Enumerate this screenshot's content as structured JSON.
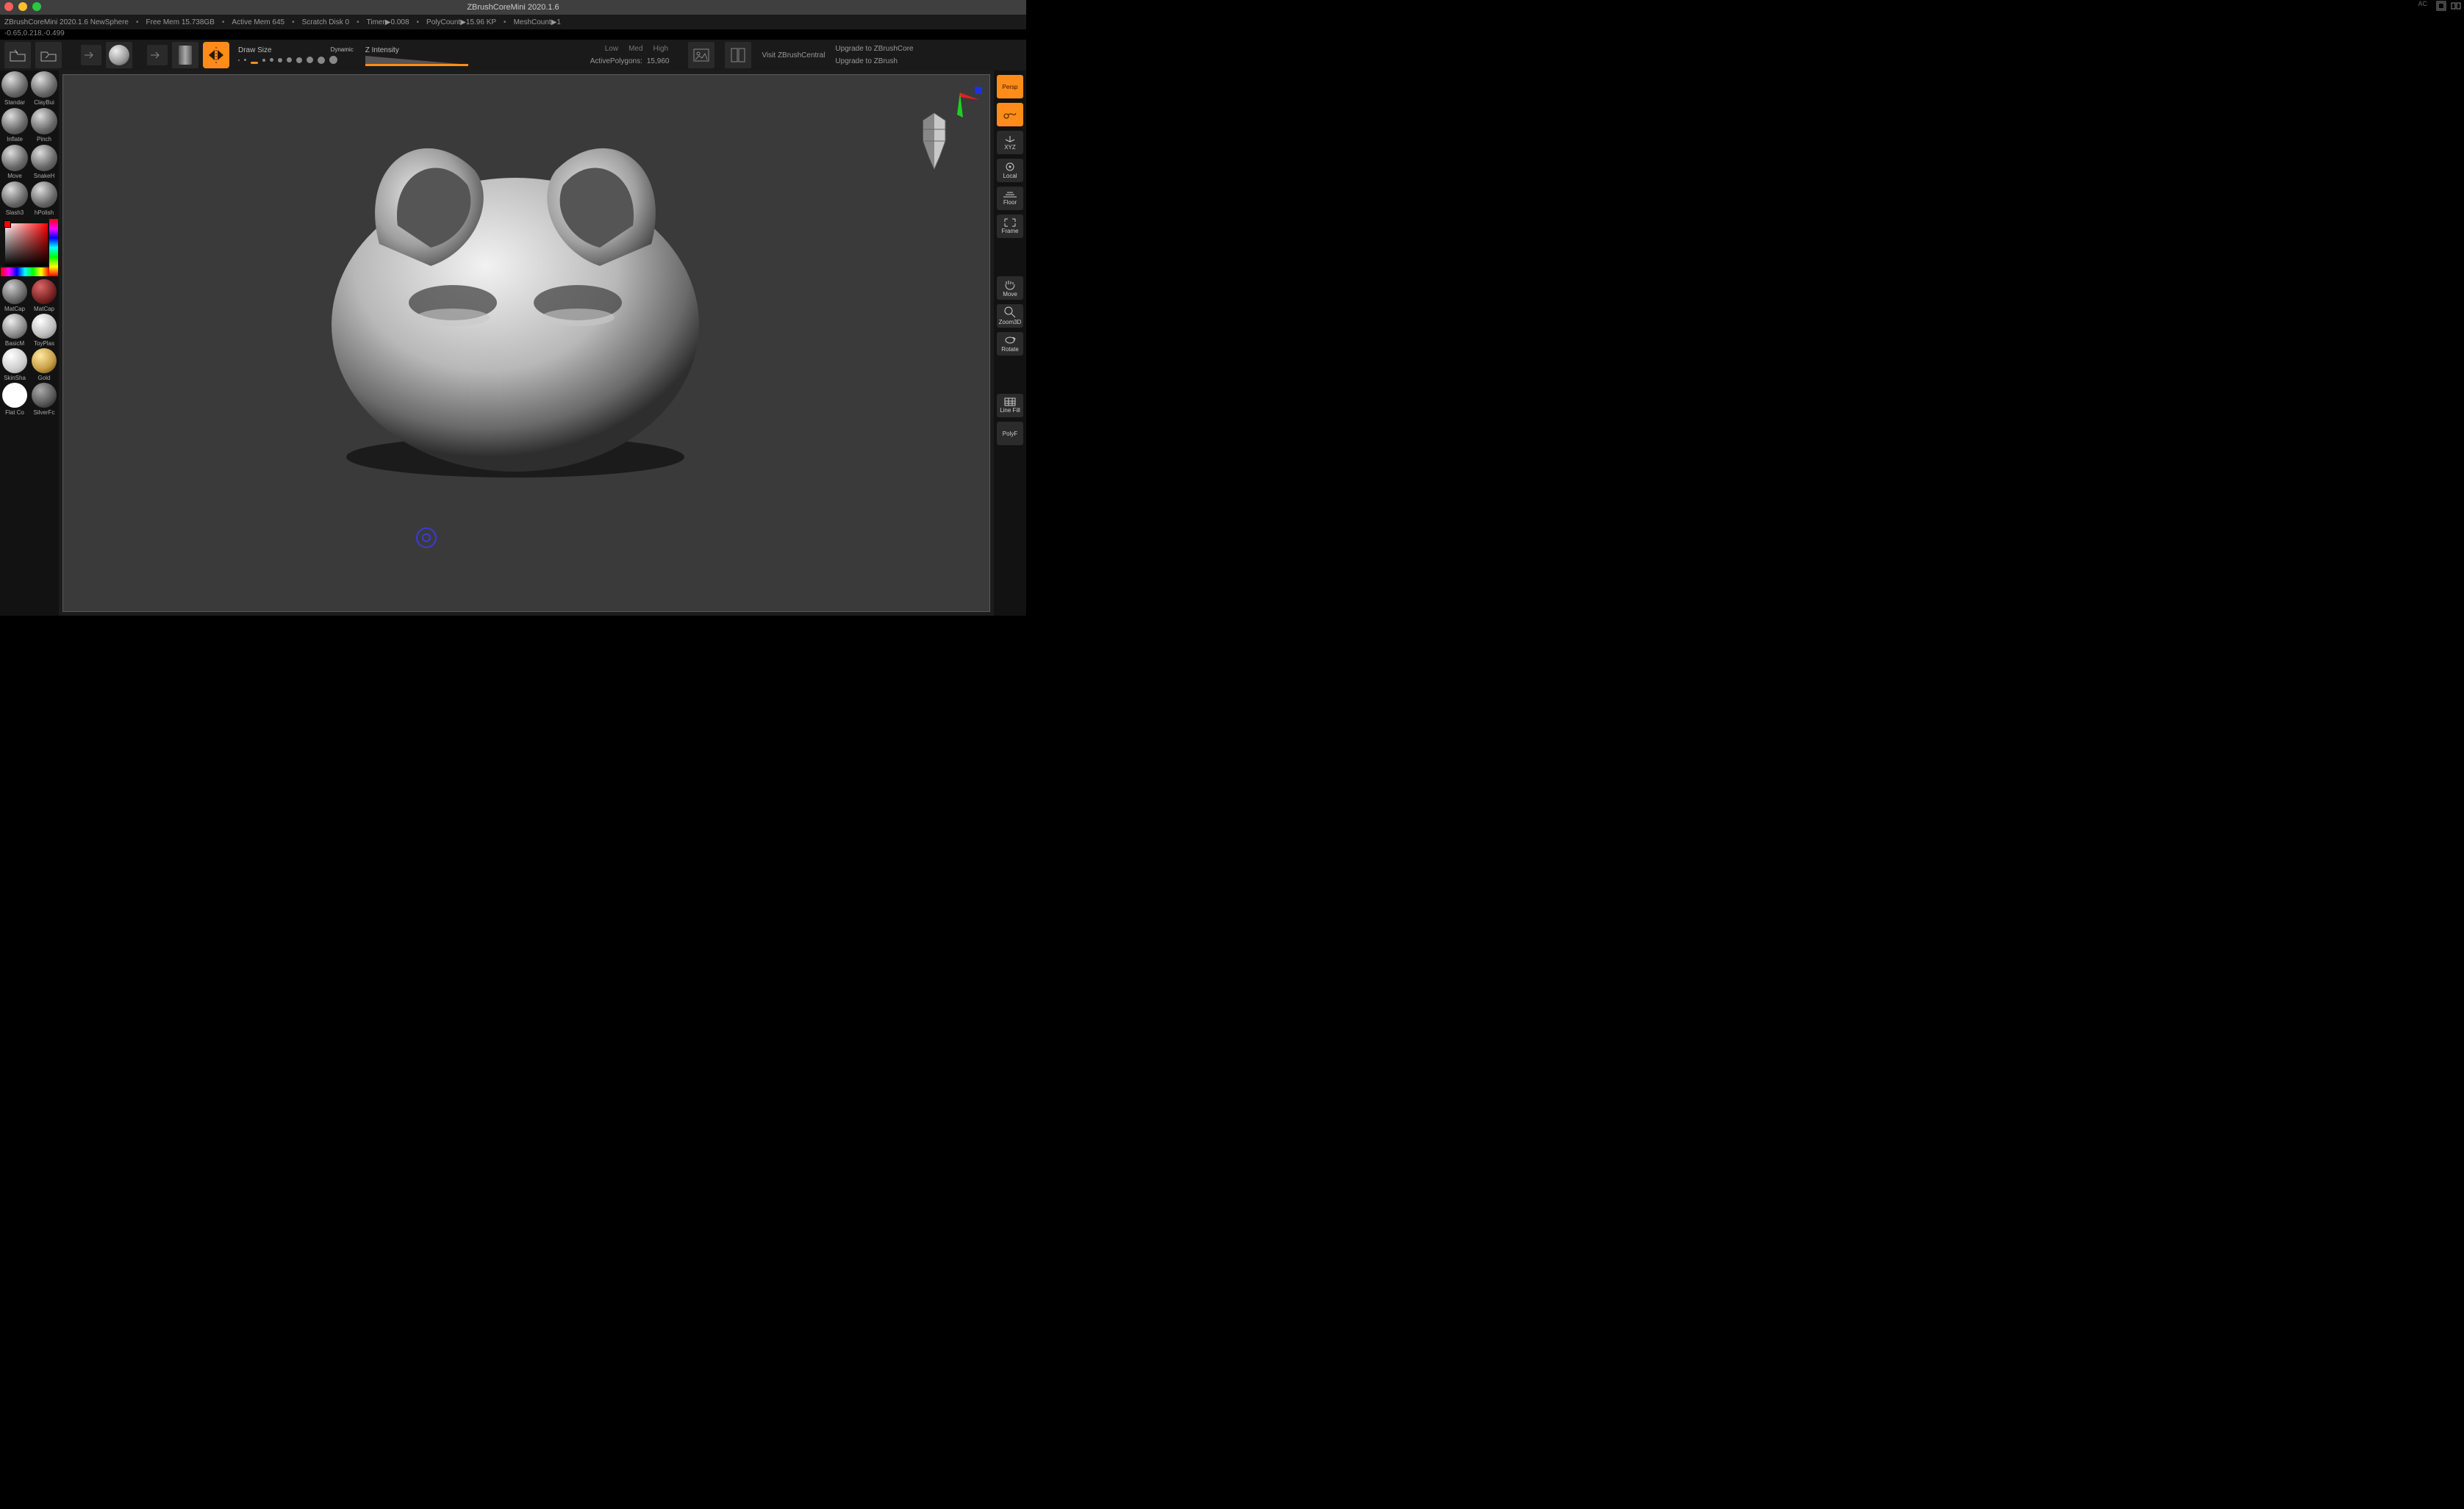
{
  "title": "ZBrushCoreMini 2020.1.6",
  "info": {
    "app": "ZBrushCoreMini 2020.1.6 NewSphere",
    "freemem_label": "Free Mem",
    "freemem": "15.738GB",
    "activemem_label": "Active Mem",
    "activemem": "645",
    "scratch_label": "Scratch Disk",
    "scratch": "0",
    "timer_label": "Timer",
    "timer": "0.008",
    "polycount_label": "PolyCount",
    "polycount": "15.96 KP",
    "meshcount_label": "MeshCount",
    "meshcount": "1",
    "ac": "AC"
  },
  "coords": "-0.65,0.218,-0.499",
  "toolbar": {
    "drawsize_label": "Draw Size",
    "dynamic_label": "Dynamic",
    "zintensity_label": "Z Intensity",
    "quality": [
      "Low",
      "Med",
      "High"
    ],
    "activepoly_label": "ActivePolygons:",
    "activepoly": "15,960",
    "visit": "Visit ZBrushCentral",
    "upgrade1": "Upgrade to ZBrushCore",
    "upgrade2": "Upgrade to ZBrush"
  },
  "brushes": [
    {
      "label": "Standar"
    },
    {
      "label": "ClayBui"
    },
    {
      "label": "Inflate"
    },
    {
      "label": "Pinch"
    },
    {
      "label": "Move"
    },
    {
      "label": "SnakeH"
    },
    {
      "label": "Slash3"
    },
    {
      "label": "hPolish"
    }
  ],
  "materials": [
    {
      "label": "MatCap",
      "bg": "radial-gradient(circle at 35% 30%,#ccc,#666 60%,#222)"
    },
    {
      "label": "MatCap",
      "bg": "radial-gradient(circle at 35% 30%,#d66,#722 60%,#200)"
    },
    {
      "label": "BasicM",
      "bg": "radial-gradient(circle at 35% 30%,#eee,#888 60%,#333)"
    },
    {
      "label": "ToyPlas",
      "bg": "radial-gradient(circle at 35% 30%,#fff,#bbb 60%,#666)"
    },
    {
      "label": "SkinSha",
      "bg": "radial-gradient(circle at 35% 30%,#fff,#ccc 60%,#888)"
    },
    {
      "label": "Gold",
      "bg": "radial-gradient(circle at 35% 30%,#ffe9a0,#caa04a 55%,#5a3d00)"
    },
    {
      "label": "Flat Co",
      "bg": "#fff"
    },
    {
      "label": "SilverFc",
      "bg": "radial-gradient(circle at 35% 30%,#aaa,#555 60%,#111)"
    }
  ],
  "right": [
    {
      "label": "Persp",
      "on": true
    },
    {
      "label": "",
      "on": true,
      "icon": "draw"
    },
    {
      "label": "XYZ",
      "on": false,
      "icon": "xyz"
    },
    {
      "label": "Local",
      "on": false,
      "icon": "local"
    },
    {
      "label": "Floor",
      "on": false,
      "icon": "floor"
    },
    {
      "label": "Frame",
      "on": false,
      "icon": "frame"
    },
    {
      "gap": true
    },
    {
      "label": "Move",
      "on": false,
      "icon": "hand"
    },
    {
      "label": "Zoom3D",
      "on": false,
      "icon": "zoom"
    },
    {
      "label": "Rotate",
      "on": false,
      "icon": "rotate"
    },
    {
      "gap": true
    },
    {
      "label": "Line Fill",
      "on": false,
      "icon": "grid"
    },
    {
      "label": "PolyF",
      "on": false,
      "icon": ""
    }
  ]
}
